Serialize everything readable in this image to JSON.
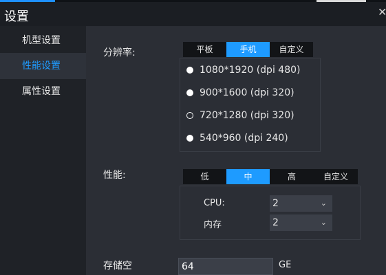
{
  "window": {
    "title": "设置",
    "close_glyph": "✕"
  },
  "sidebar": {
    "items": [
      {
        "label": "机型设置",
        "active": false
      },
      {
        "label": "性能设置",
        "active": true
      },
      {
        "label": "属性设置",
        "active": false
      }
    ]
  },
  "resolution": {
    "label": "分辨率:",
    "tabs": [
      "平板",
      "手机",
      "自定义"
    ],
    "active_tab": "手机",
    "options": [
      {
        "label": "1080*1920 (dpi 480)",
        "state": "filled"
      },
      {
        "label": "900*1600 (dpi 320)",
        "state": "filled"
      },
      {
        "label": "720*1280 (dpi 320)",
        "state": "selected-ring"
      },
      {
        "label": "540*960 (dpi 240)",
        "state": "filled"
      }
    ]
  },
  "performance": {
    "label": "性能:",
    "tabs": [
      "低",
      "中",
      "高",
      "自定义"
    ],
    "active_tab": "中",
    "cpu": {
      "label": "CPU:",
      "value": "2"
    },
    "memory": {
      "label": "内存",
      "value": "2"
    }
  },
  "storage": {
    "label": "存储空",
    "value": "64",
    "unit": "GE"
  },
  "colors": {
    "accent": "#1e9bff",
    "panel": "#2b2e35",
    "sidebar": "#1f2227",
    "titlebar": "#1b1e23"
  },
  "icons": {
    "close": "close-icon",
    "dropdown": "chevron-down-icon",
    "radio": "radio-button-icon"
  }
}
